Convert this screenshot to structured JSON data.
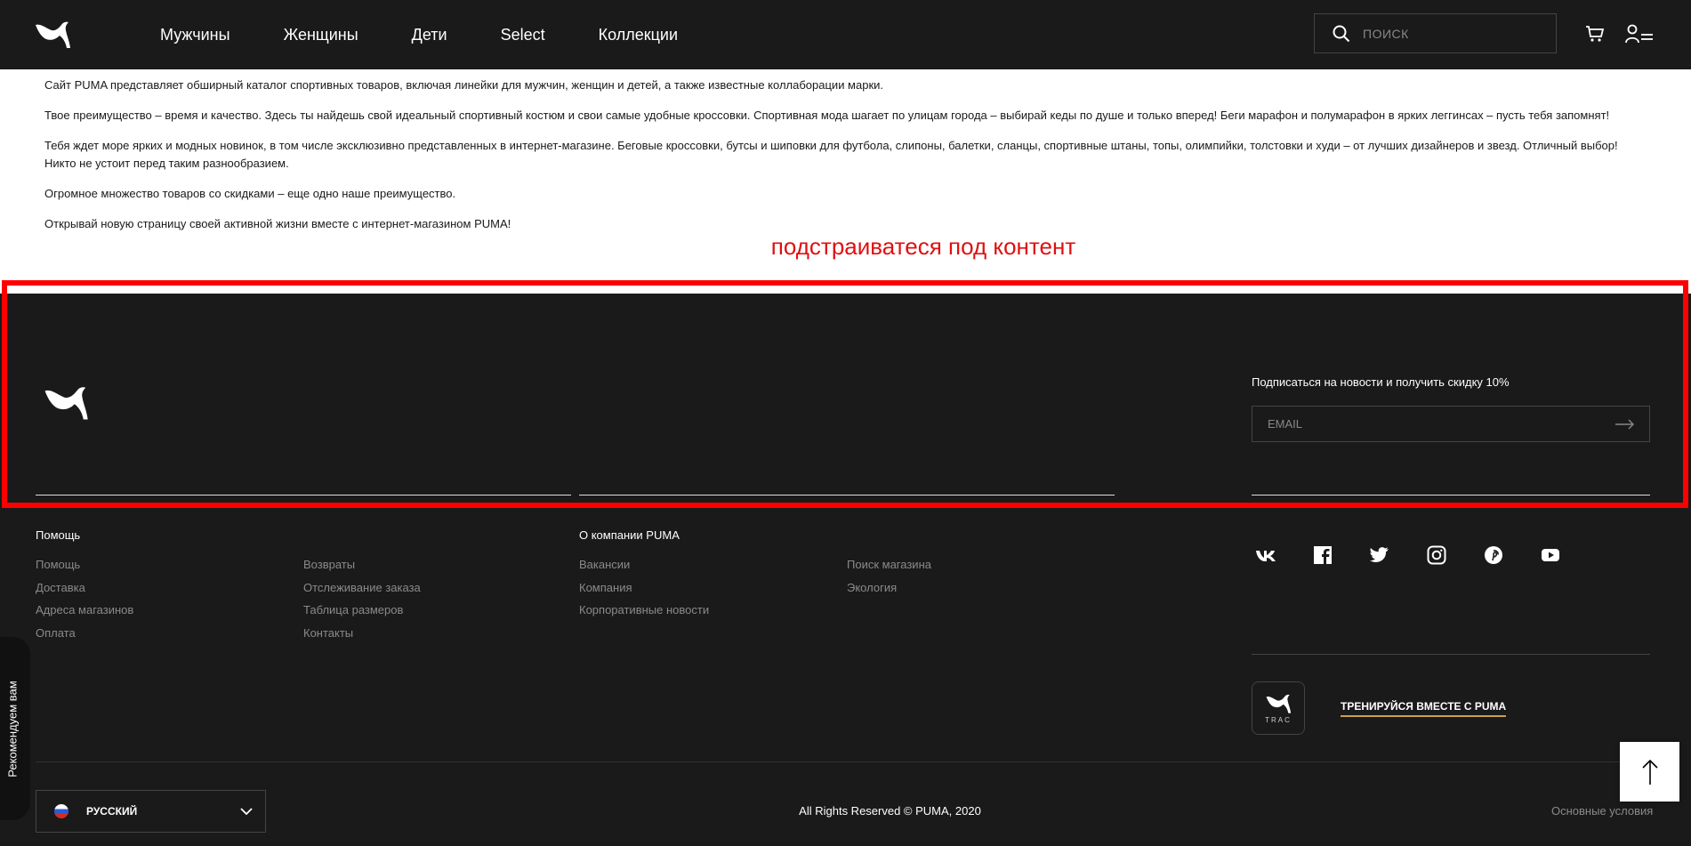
{
  "header": {
    "nav": [
      "Мужчины",
      "Женщины",
      "Дети",
      "Select",
      "Коллекции"
    ],
    "search_placeholder": "ПОИСК"
  },
  "seo": [
    "Сайт PUMA представляет обширный каталог спортивных товаров, включая линейки для мужчин, женщин и детей, а также известные коллаборации марки.",
    "Твое преимущество – время и качество. Здесь ты найдешь свой идеальный спортивный костюм и свои самые удобные кроссовки. Спортивная мода шагает по улицам города – выбирай кеды по душе и только вперед! Беги марафон и полумарафон в ярких леггинсах – пусть тебя запомнят!",
    "Тебя ждет море ярких и модных новинок, в том числе эксклюзивно представленных в интернет-магазине. Беговые кроссовки, бутсы и шиповки для футбола, слипоны, балетки, сланцы, спортивные штаны, топы, олимпийки, толстовки и худи – от лучших дизайнеров и звезд. Отличный выбор! Никто не устоит перед таким разнообразием.",
    "Огромное множество товаров со скидками – еще одно наше преимущество.",
    "Открывай новую страницу своей активной жизни вместе с интернет-магазином PUMA!"
  ],
  "annotation": "подстраиватеся под контент",
  "footer": {
    "subscribe_title": "Подписаться на новости и получить скидку 10%",
    "email_placeholder": "EMAIL",
    "help": {
      "title": "Помощь",
      "col1": [
        "Помощь",
        "Доставка",
        "Адреса магазинов",
        "Оплата"
      ],
      "col2": [
        "Возвраты",
        "Отслеживание заказа",
        "Таблица размеров",
        "Контакты"
      ]
    },
    "company": {
      "title": "О компании PUMA",
      "col1": [
        "Вакансии",
        "Компания",
        "Корпоративные новости"
      ],
      "col2": [
        "Поиск магазина",
        "Экология"
      ]
    },
    "socials": [
      "vk-icon",
      "facebook-icon",
      "twitter-icon",
      "instagram-icon",
      "pinterest-icon",
      "youtube-icon"
    ],
    "trac_label": "TRAC",
    "trac_link": "ТРЕНИРУЙСЯ ВМЕСТЕ С PUMA",
    "language": "РУССКИЙ",
    "copyright": "All Rights Reserved © PUMA, 2020",
    "terms": "Основные условия"
  },
  "recommend_tab": "Рекомендуем вам",
  "colors": {
    "dark": "#1a1a1a",
    "highlight": "#ff0000",
    "accent": "#c8a050"
  }
}
